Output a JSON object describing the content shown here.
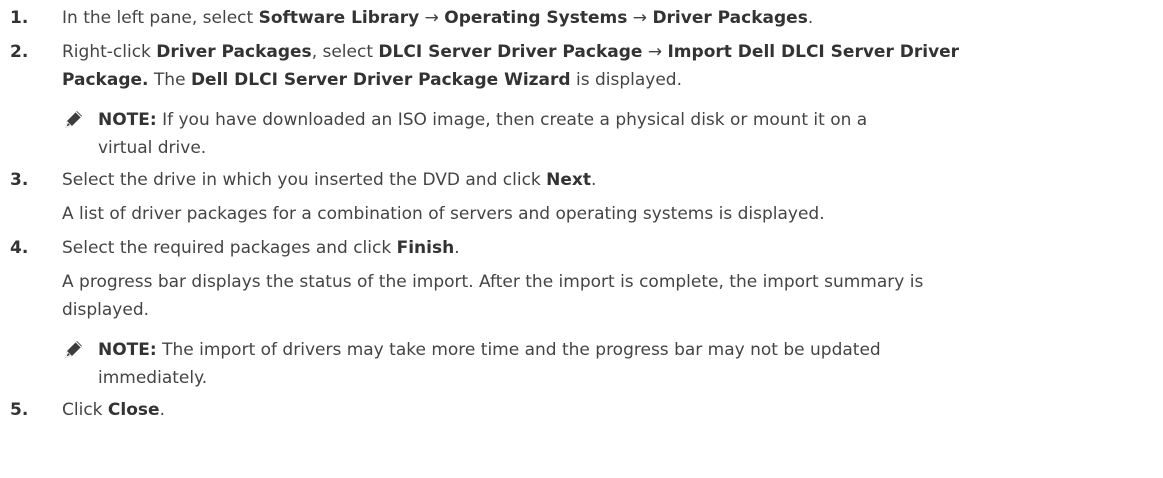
{
  "steps": [
    {
      "number": "1.",
      "parts": {
        "t1": "In the left pane, select ",
        "b1": "Software Library",
        "t2": " → ",
        "b2": "Operating Systems",
        "t3": " → ",
        "b3": "Driver Packages",
        "t4": "."
      }
    },
    {
      "number": "2.",
      "parts": {
        "t1": "Right-click ",
        "b1": "Driver Packages",
        "t2": ", select ",
        "b2": "DLCI Server Driver Package",
        "t3": " → ",
        "b3": "Import Dell DLCI Server Driver",
        "b4": "Package.",
        "t4": " The ",
        "b5": "Dell DLCI Server Driver Package Wizard",
        "t5": " is displayed."
      },
      "note": {
        "label": "NOTE:",
        "line1": " If you have downloaded an ISO image, then create a physical disk or mount it on a",
        "line2": "virtual drive."
      }
    },
    {
      "number": "3.",
      "parts": {
        "t1": "Select the drive in which you inserted the DVD and click ",
        "b1": "Next",
        "t2": "."
      },
      "result": "A list of driver packages for a combination of servers and operating systems is displayed."
    },
    {
      "number": "4.",
      "parts": {
        "t1": "Select the required packages and click ",
        "b1": "Finish",
        "t2": "."
      },
      "result_line1": "A progress bar displays the status of the import. After the import is complete, the import summary is",
      "result_line2": "displayed.",
      "note": {
        "label": "NOTE:",
        "line1": " The import of drivers may take more time and the progress bar may not be updated",
        "line2": "immediately."
      }
    },
    {
      "number": "5.",
      "parts": {
        "t1": "Click ",
        "b1": "Close",
        "t2": "."
      }
    }
  ],
  "icons": {
    "note": "pencil-note-icon"
  },
  "colors": {
    "text": "#444444",
    "bold": "#333333",
    "icon": "#3d3d3d"
  }
}
